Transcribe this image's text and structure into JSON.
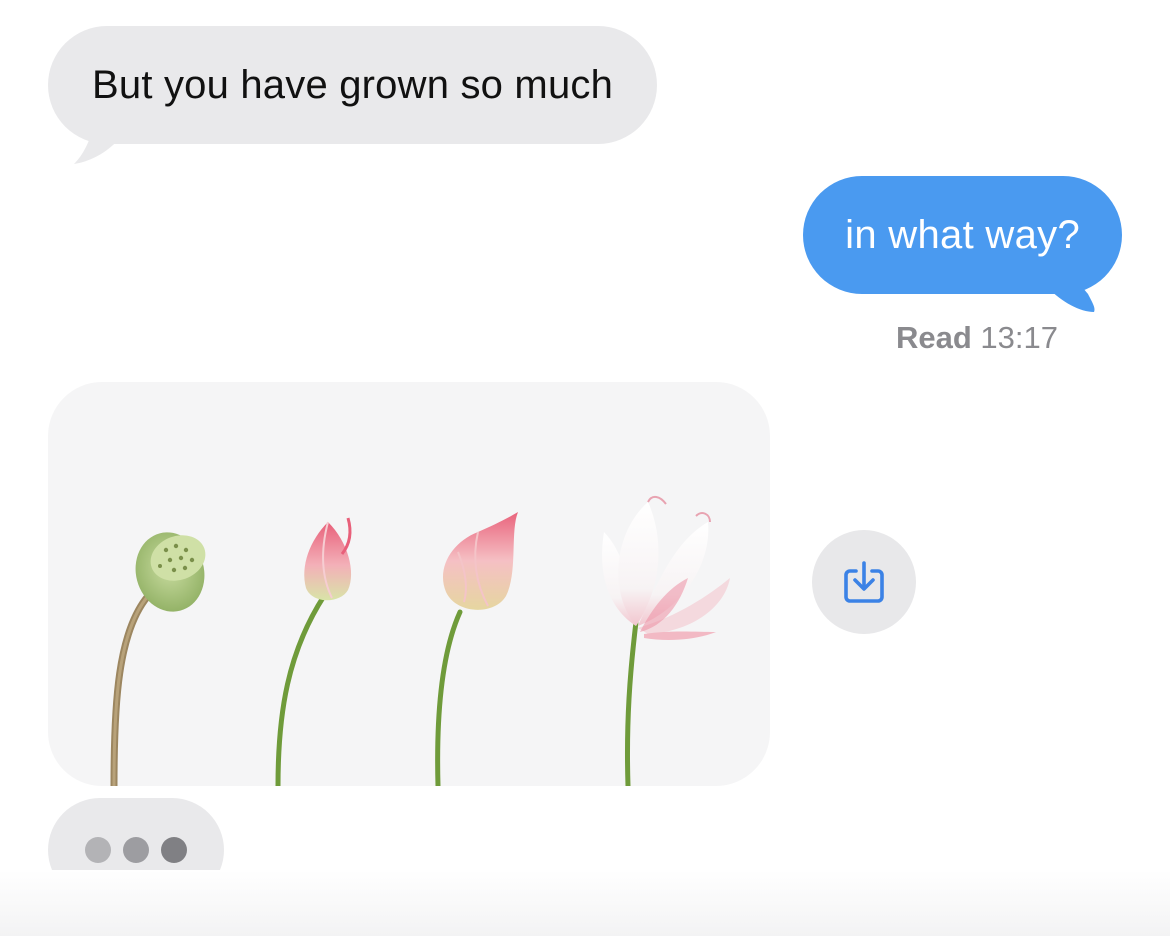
{
  "conversation": {
    "messages": [
      {
        "direction": "incoming",
        "text": "But you have grown so much"
      },
      {
        "direction": "outgoing",
        "text": "in what way?"
      }
    ],
    "read_receipt": {
      "label": "Read",
      "time": "13:17"
    },
    "image_message": {
      "description_icon": "lotus-growth-stages-image",
      "save_icon": "save-download-icon"
    },
    "typing_indicator": {
      "dot_colors": [
        "#b3b3b6",
        "#9d9da1",
        "#808084"
      ]
    }
  },
  "colors": {
    "incoming_bubble": "#e9e9eb",
    "outgoing_bubble": "#4a9af0",
    "accent": "#3b82e6",
    "receipt_text": "#8a8a8e"
  }
}
